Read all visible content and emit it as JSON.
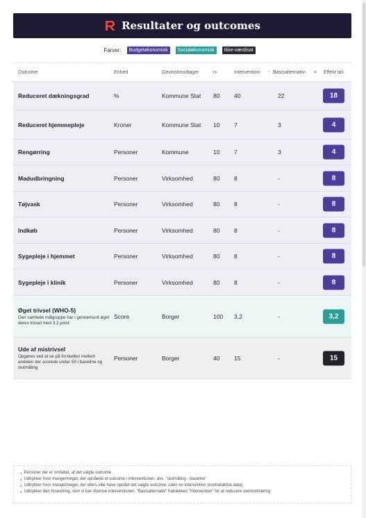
{
  "header": {
    "title": "Resultater og outcomes",
    "logo_icon": "r-logo-icon"
  },
  "legend": {
    "label": "Farver:",
    "chips": [
      {
        "label": "Budgetøkonomisk",
        "color": "#4c3d9a"
      },
      {
        "label": "Socialøkonomisk",
        "color": "#2a9d96"
      },
      {
        "label": "Ikke-værdisat",
        "color": "#2a2833"
      }
    ]
  },
  "columns": {
    "outcome": "Outcome",
    "enhed": "Enhed",
    "gevinst": "Gevinstmodtager",
    "n": "n",
    "n_sup": "1",
    "intervention": "Intervention",
    "intervention_sup": "2",
    "minus": "-",
    "basis": "Basisalternativ",
    "basis_sup": "3",
    "equals": "=",
    "effekt": "Effekt tal",
    "effekt_sup": "4"
  },
  "rows": [
    {
      "outcome": "Reduceret dækningsgrad",
      "desc": "",
      "enhed": "%",
      "gevinst": "Kommune Stat",
      "n": "80",
      "intervention": "40",
      "basis": "22",
      "effekt": "18",
      "type": "budget"
    },
    {
      "outcome": "Reduceret hjemmepleje",
      "desc": "",
      "enhed": "Kroner",
      "gevinst": "Kommune Stat",
      "n": "10",
      "intervention": "7",
      "basis": "3",
      "effekt": "4",
      "type": "budget"
    },
    {
      "outcome": "Rengørring",
      "desc": "",
      "enhed": "Personer",
      "gevinst": "Kommune",
      "n": "10",
      "intervention": "7",
      "basis": "3",
      "effekt": "4",
      "type": "budget"
    },
    {
      "outcome": "Madudbringning",
      "desc": "",
      "enhed": "Personer",
      "gevinst": "Virksomhed",
      "n": "80",
      "intervention": "8",
      "basis": "-",
      "effekt": "8",
      "type": "budget"
    },
    {
      "outcome": "Tøjvask",
      "desc": "",
      "enhed": "Personer",
      "gevinst": "Virksomhed",
      "n": "80",
      "intervention": "8",
      "basis": "-",
      "effekt": "8",
      "type": "budget"
    },
    {
      "outcome": "Indkøb",
      "desc": "",
      "enhed": "Personer",
      "gevinst": "Virksomhed",
      "n": "80",
      "intervention": "8",
      "basis": "-",
      "effekt": "8",
      "type": "budget"
    },
    {
      "outcome": "Sygepleje i hjemmet",
      "desc": "",
      "enhed": "Personer",
      "gevinst": "Virksomhed",
      "n": "80",
      "intervention": "8",
      "basis": "-",
      "effekt": "8",
      "type": "budget"
    },
    {
      "outcome": "Sygepleje i klinik",
      "desc": "",
      "enhed": "Personer",
      "gevinst": "Virksomhed",
      "n": "80",
      "intervention": "8",
      "basis": "-",
      "effekt": "8",
      "type": "budget"
    },
    {
      "outcome": "Øget trivsel (WHO-5)",
      "desc": "Den samlede målgruppe har i gennemsnit øget deres trivsel med 3.2 point",
      "enhed": "Score",
      "gevinst": "Borger",
      "n": "100",
      "intervention": "3,2",
      "basis": "-",
      "effekt": "3,2",
      "type": "social"
    },
    {
      "outcome": "Ude af mistrivsel",
      "desc": "Opgøres ved at se på forskellen mellem andelen der scorede under 50 i baseline og slutmåling",
      "enhed": "Personer",
      "gevinst": "Borger",
      "n": "40",
      "intervention": "15",
      "basis": "-",
      "effekt": "15",
      "type": "ikke"
    }
  ],
  "footnotes": [
    {
      "num": "1",
      "text": "Personer der er omfattet, af det valgte outcome"
    },
    {
      "num": "2",
      "text": "Udtrykker hvor mange/meget, der opnåede et outcome i interventionen, dvs. \"slutmåling - baseline\""
    },
    {
      "num": "3",
      "text": "Udtrykker hvor mange/meget, der ellers ville have opnået det valgte outcome, uden en intervention (kontrafaktisk data)"
    },
    {
      "num": "4",
      "text": "Udtrykker den forandring, som vi kan tilskrive interventionen. \"Basisalternativ\" fratrækkes \"Intervention\" for at reducere overestimering"
    }
  ]
}
